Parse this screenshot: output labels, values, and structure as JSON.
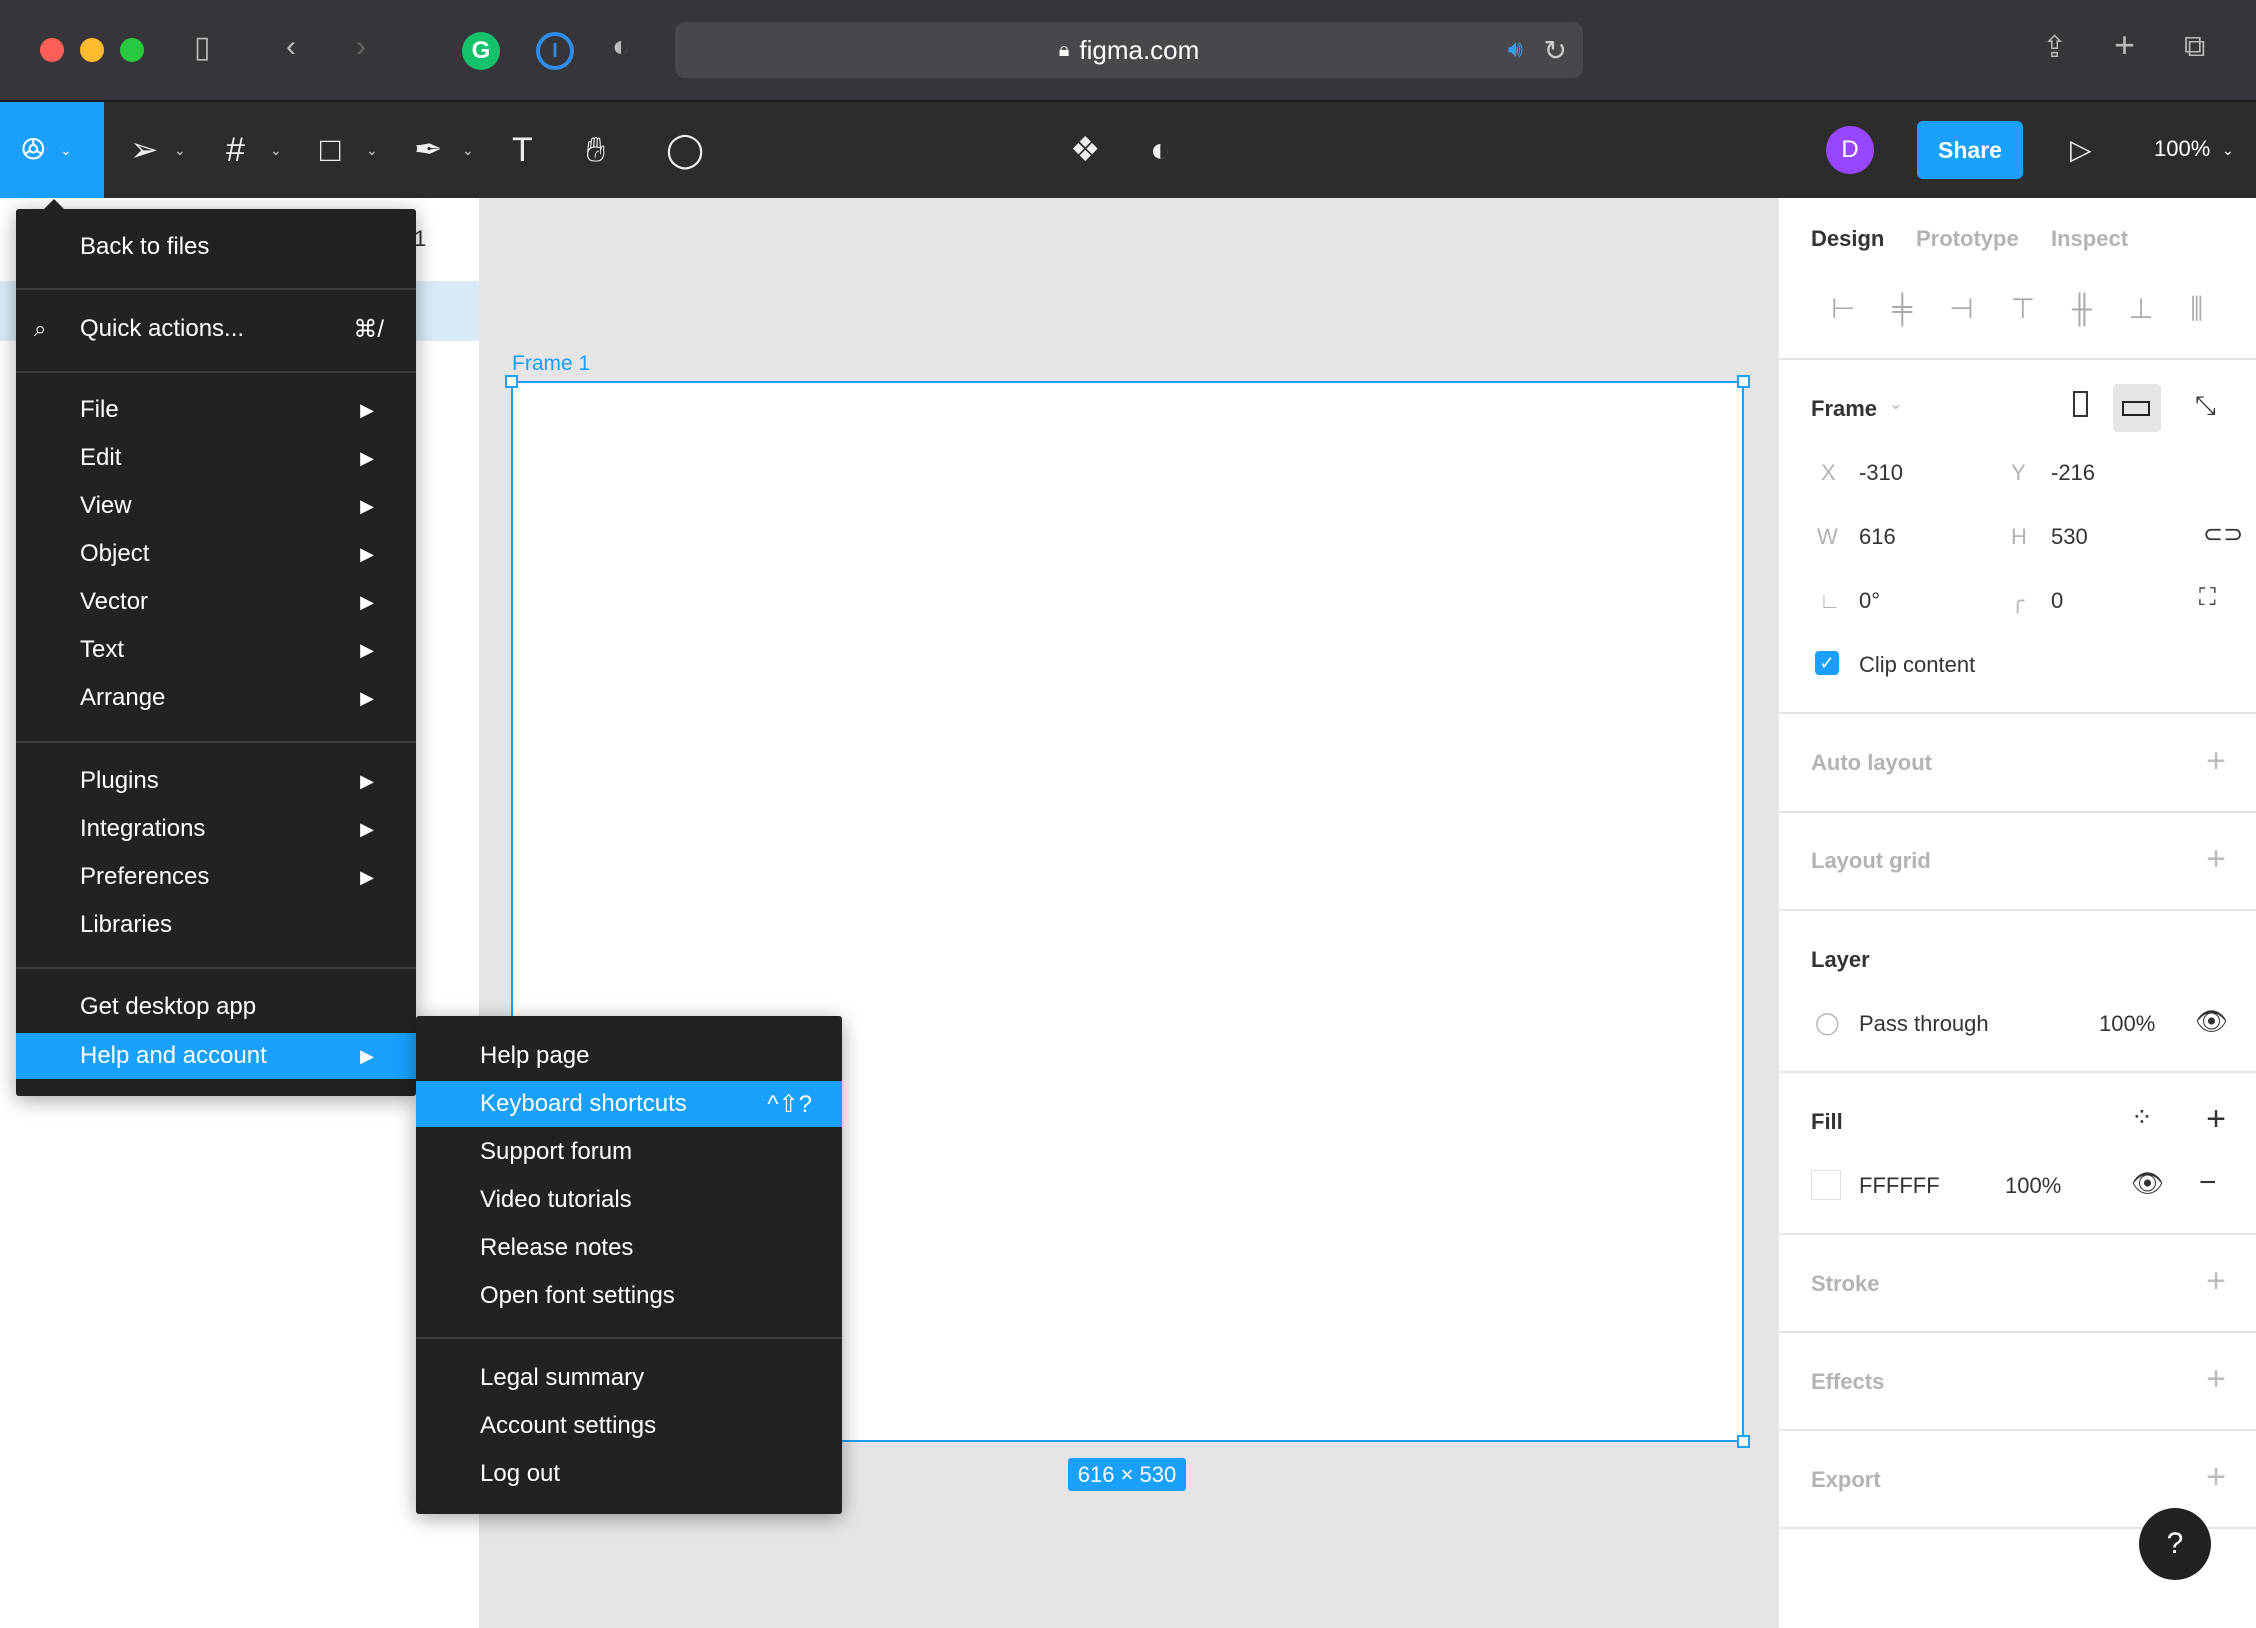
{
  "browser": {
    "url": "figma.com"
  },
  "toolbar": {
    "avatar_initial": "D",
    "share_label": "Share",
    "zoom": "100%",
    "colors": {
      "accent": "#18a0fb",
      "avatar": "#9747ff"
    }
  },
  "left_panel": {
    "page_fragment": "1"
  },
  "canvas": {
    "frame_label": "Frame 1",
    "dimensions": "616 × 530"
  },
  "main_menu": {
    "back": "Back to files",
    "quick_actions": "Quick actions...",
    "quick_shortcut": "⌘/",
    "group1": [
      "File",
      "Edit",
      "View",
      "Object",
      "Vector",
      "Text",
      "Arrange"
    ],
    "group2": [
      "Plugins",
      "Integrations",
      "Preferences",
      "Libraries"
    ],
    "desktop": "Get desktop app",
    "help": "Help and account"
  },
  "help_submenu": {
    "items": [
      "Help page",
      "Keyboard shortcuts",
      "Support forum",
      "Video tutorials",
      "Release notes",
      "Open font settings"
    ],
    "shortcut": "^⇧?",
    "items2": [
      "Legal summary",
      "Account settings",
      "Log out"
    ]
  },
  "right_panel": {
    "tabs": [
      "Design",
      "Prototype",
      "Inspect"
    ],
    "frame": {
      "title": "Frame",
      "x_label": "X",
      "x": "-310",
      "y_label": "Y",
      "y": "-216",
      "w_label": "W",
      "w": "616",
      "h_label": "H",
      "h": "530",
      "rotation": "0°",
      "radius": "0",
      "clip_label": "Clip content",
      "clip_checked": true
    },
    "auto_layout": "Auto layout",
    "layout_grid": "Layout grid",
    "layer": {
      "title": "Layer",
      "blend": "Pass through",
      "opacity": "100%"
    },
    "fill": {
      "title": "Fill",
      "hex": "FFFFFF",
      "opacity": "100%"
    },
    "stroke": "Stroke",
    "effects": "Effects",
    "export": "Export",
    "help": "?"
  }
}
